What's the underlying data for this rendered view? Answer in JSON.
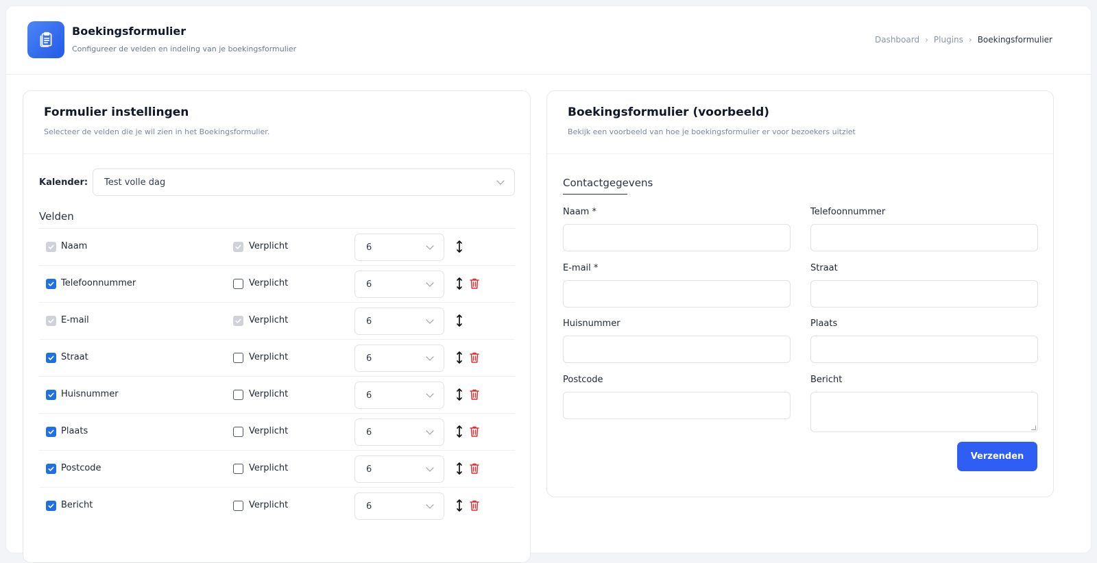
{
  "header": {
    "title": "Boekingsformulier",
    "subtitle": "Configureer de velden en indeling van je boekingsformulier",
    "breadcrumb": [
      "Dashboard",
      "Plugins",
      "Boekingsformulier"
    ],
    "icon": "clipboard-icon",
    "accent": "#2f5ef5"
  },
  "settings": {
    "title": "Formulier instellingen",
    "subtitle": "Selecteer de velden die je wil zien in het Boekingsformulier.",
    "calendar_label": "Kalender:",
    "calendar_value": "Test volle dag",
    "fields_title": "Velden",
    "required_label": "Verplicht",
    "fields": [
      {
        "name": "Naam",
        "enabled": true,
        "locked": true,
        "required": true,
        "width": "6",
        "deletable": false
      },
      {
        "name": "Telefoonnummer",
        "enabled": true,
        "locked": false,
        "required": false,
        "width": "6",
        "deletable": true
      },
      {
        "name": "E-mail",
        "enabled": true,
        "locked": true,
        "required": true,
        "width": "6",
        "deletable": false
      },
      {
        "name": "Straat",
        "enabled": true,
        "locked": false,
        "required": false,
        "width": "6",
        "deletable": true
      },
      {
        "name": "Huisnummer",
        "enabled": true,
        "locked": false,
        "required": false,
        "width": "6",
        "deletable": true
      },
      {
        "name": "Plaats",
        "enabled": true,
        "locked": false,
        "required": false,
        "width": "6",
        "deletable": true
      },
      {
        "name": "Postcode",
        "enabled": true,
        "locked": false,
        "required": false,
        "width": "6",
        "deletable": true
      },
      {
        "name": "Bericht",
        "enabled": true,
        "locked": false,
        "required": false,
        "width": "6",
        "deletable": true
      }
    ]
  },
  "preview": {
    "title": "Boekingsformulier (voorbeeld)",
    "subtitle": "Bekijk een voorbeeld van hoe je boekingsformulier er voor bezoekers uitziet",
    "section_title": "Contactgegevens",
    "labels": [
      "Naam *",
      "Telefoonnummer",
      "E-mail *",
      "Straat",
      "Huisnummer",
      "Plaats",
      "Postcode",
      "Bericht"
    ],
    "submit_label": "Verzenden"
  }
}
